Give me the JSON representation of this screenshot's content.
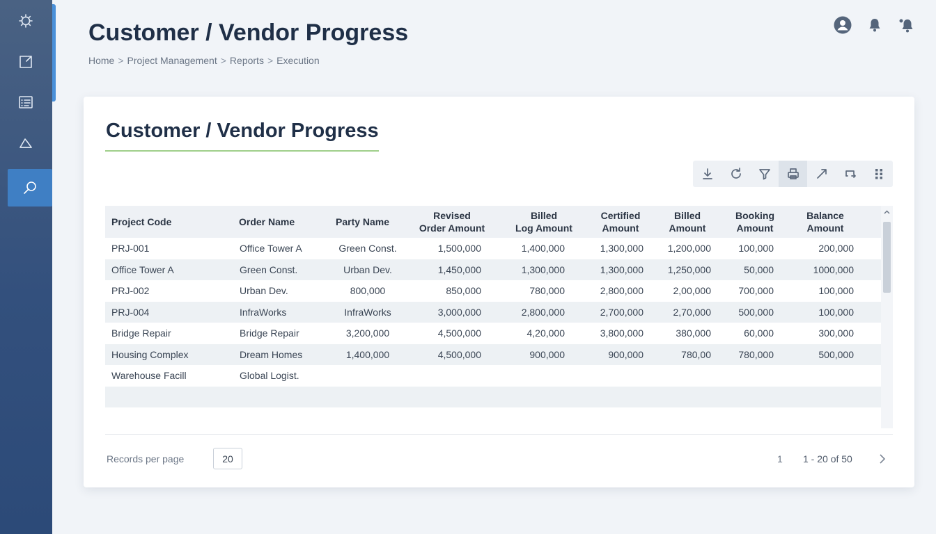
{
  "header": {
    "title": "Customer / Vendor Progress",
    "breadcrumb": [
      "Home",
      "Project Management",
      "Reports",
      "Execution"
    ],
    "breadcrumb_sep": ">"
  },
  "sidebar": {
    "items": [
      {
        "name": "settings",
        "icon": "gear-icon"
      },
      {
        "name": "share",
        "icon": "share-icon"
      },
      {
        "name": "list",
        "icon": "checklist-icon"
      },
      {
        "name": "shapes",
        "icon": "shapes-icon"
      },
      {
        "name": "search",
        "icon": "search-icon",
        "active": true
      }
    ]
  },
  "header_icons": [
    "user-avatar-icon",
    "bell-icon",
    "bell-notify-icon"
  ],
  "card": {
    "title": "Customer / Vendor Progress",
    "toolbar": [
      "download-icon",
      "refresh-icon",
      "filter-icon",
      "print-icon",
      "expand-icon",
      "export-icon",
      "grid-icon"
    ]
  },
  "table": {
    "columns": [
      {
        "l1": "Project Code",
        "l2": ""
      },
      {
        "l1": "Order Name",
        "l2": ""
      },
      {
        "l1": "Party Name",
        "l2": ""
      },
      {
        "l1": "Revised",
        "l2": "Order Amount"
      },
      {
        "l1": "Billed",
        "l2": "Log Amount"
      },
      {
        "l1": "Certified",
        "l2": "Amount"
      },
      {
        "l1": "Billed",
        "l2": "Amount"
      },
      {
        "l1": "Booking",
        "l2": "Amount"
      },
      {
        "l1": "Balance",
        "l2": "Amount"
      }
    ],
    "rows": [
      [
        "PRJ-001",
        "Office Tower A",
        "Green Const.",
        "1,500,000",
        "1,400,000",
        "1,300,000",
        "1,200,000",
        "100,000",
        "200,000"
      ],
      [
        "Office Tower A",
        "Green Const.",
        "Urban Dev.",
        "1,450,000",
        "1,300,000",
        "1,300,000",
        "1,250,000",
        "50,000",
        "1000,000"
      ],
      [
        "PRJ-002",
        "Urban Dev.",
        "800,000",
        "850,000",
        "780,000",
        "2,800,000",
        "2,00,000",
        "700,000",
        "100,000"
      ],
      [
        "PRJ-004",
        "InfraWorks",
        "InfraWorks",
        "3,000,000",
        "2,800,000",
        "2,700,000",
        "2,70,000",
        "500,000",
        "100,000"
      ],
      [
        "Bridge Repair",
        "Bridge Repair",
        "3,200,000",
        "4,500,000",
        "4,20,000",
        "3,800,000",
        "380,000",
        "60,000",
        "300,000"
      ],
      [
        "Housing Complex",
        "Dream Homes",
        "1,400,000",
        "4,500,000",
        "900,000",
        "900,000",
        "780,00",
        "780,000",
        "500,000"
      ],
      [
        "Warehouse Facill",
        "Global Logist.",
        "",
        "",
        "",
        "",
        "",
        "",
        ""
      ],
      [
        "",
        "",
        "",
        "",
        "",
        "",
        "",
        "",
        ""
      ],
      [
        "",
        "",
        "",
        "",
        "",
        "",
        "",
        "",
        ""
      ]
    ]
  },
  "footer": {
    "records_label": "Records per page",
    "records_value": "20",
    "page": "1",
    "range": "1 - 20 of 50"
  }
}
